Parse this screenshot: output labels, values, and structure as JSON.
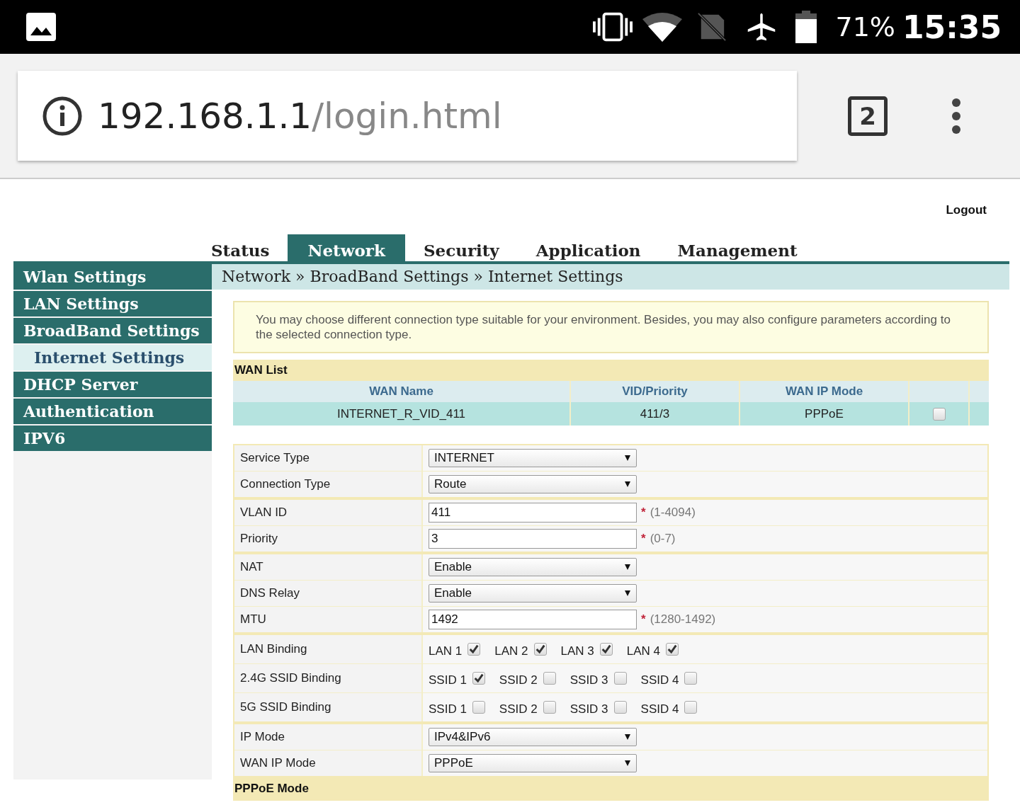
{
  "status_bar": {
    "battery": "71%",
    "time": "15:35"
  },
  "browser": {
    "url_host": "192.168.1.1",
    "url_path": "/login.html",
    "tab_count": "2"
  },
  "logout": "Logout",
  "tabs": [
    {
      "label": "Status",
      "selected": false
    },
    {
      "label": "Network",
      "selected": true
    },
    {
      "label": "Security",
      "selected": false
    },
    {
      "label": "Application",
      "selected": false
    },
    {
      "label": "Management",
      "selected": false
    }
  ],
  "sidebar": {
    "items": [
      {
        "label": "Wlan Settings",
        "selected": false
      },
      {
        "label": "LAN Settings",
        "selected": false
      },
      {
        "label": "BroadBand Settings",
        "selected": false,
        "children": [
          {
            "label": "Internet Settings",
            "selected": true
          }
        ]
      },
      {
        "label": "DHCP Server",
        "selected": false
      },
      {
        "label": "Authentication",
        "selected": false
      },
      {
        "label": "IPV6",
        "selected": false
      }
    ]
  },
  "breadcrumb": "Network » BroadBand Settings » Internet Settings",
  "notice": "You may choose different connection type suitable for your environment. Besides, you may also configure parameters according to the selected connection type.",
  "wan_list": {
    "title": "WAN List",
    "columns": [
      "WAN Name",
      "VID/Priority",
      "WAN IP Mode"
    ],
    "rows": [
      {
        "cells": [
          "INTERNET_R_VID_411",
          "411/3",
          "PPPoE"
        ],
        "checked": false
      }
    ]
  },
  "form": {
    "groups": [
      {
        "rows": [
          {
            "kind": "select",
            "label": "Service Type",
            "value": "INTERNET"
          },
          {
            "kind": "select",
            "label": "Connection Type",
            "value": "Route"
          }
        ]
      },
      {
        "rows": [
          {
            "kind": "text",
            "label": "VLAN ID",
            "value": "411",
            "mark": "*",
            "hint": "(1-4094)"
          },
          {
            "kind": "text",
            "label": "Priority",
            "value": "3",
            "mark": "*",
            "hint": "(0-7)"
          }
        ]
      },
      {
        "rows": [
          {
            "kind": "select",
            "label": "NAT",
            "value": "Enable"
          },
          {
            "kind": "select",
            "label": "DNS Relay",
            "value": "Enable"
          },
          {
            "kind": "text",
            "label": "MTU",
            "value": "1492",
            "mark": "*",
            "hint": "(1280-1492)"
          }
        ]
      },
      {
        "rows": [
          {
            "kind": "checks",
            "label": "LAN Binding",
            "options": [
              {
                "label": "LAN 1",
                "checked": true
              },
              {
                "label": "LAN 2",
                "checked": true
              },
              {
                "label": "LAN 3",
                "checked": true
              },
              {
                "label": "LAN 4",
                "checked": true
              }
            ]
          },
          {
            "kind": "checks",
            "label": "2.4G SSID Binding",
            "options": [
              {
                "label": "SSID 1",
                "checked": true
              },
              {
                "label": "SSID 2",
                "checked": false
              },
              {
                "label": "SSID 3",
                "checked": false
              },
              {
                "label": "SSID 4",
                "checked": false
              }
            ]
          },
          {
            "kind": "checks",
            "label": "5G SSID Binding",
            "options": [
              {
                "label": "SSID 1",
                "checked": false
              },
              {
                "label": "SSID 2",
                "checked": false
              },
              {
                "label": "SSID 3",
                "checked": false
              },
              {
                "label": "SSID 4",
                "checked": false
              }
            ]
          }
        ]
      },
      {
        "rows": [
          {
            "kind": "select",
            "label": "IP Mode",
            "value": "IPv4&IPv6"
          },
          {
            "kind": "select",
            "label": "WAN IP Mode",
            "value": "PPPoE"
          }
        ]
      }
    ]
  },
  "pppoe_section": {
    "title": "PPPoE Mode"
  }
}
